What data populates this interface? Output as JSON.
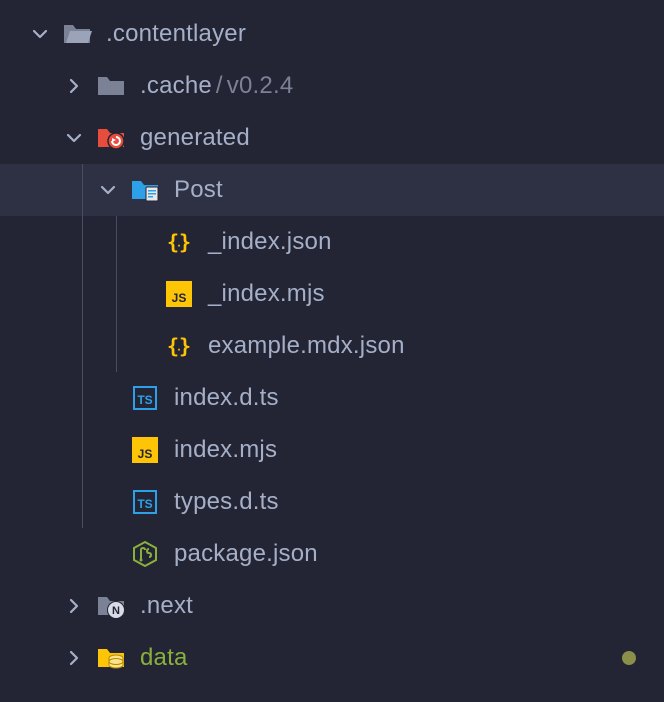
{
  "tree": {
    "contentlayer": {
      "label": ".contentlayer"
    },
    "cache": {
      "label": ".cache",
      "version_sep": "/",
      "version": "v0.2.4"
    },
    "generated": {
      "label": "generated"
    },
    "post": {
      "label": "Post"
    },
    "index_json": {
      "label": "_index.json"
    },
    "index_mjs": {
      "label": "_index.mjs"
    },
    "example_mdx_json": {
      "label": "example.mdx.json"
    },
    "index_d_ts": {
      "label": "index.d.ts"
    },
    "index_mjs2": {
      "label": "index.mjs"
    },
    "types_d_ts": {
      "label": "types.d.ts"
    },
    "package_json": {
      "label": "package.json"
    },
    "next": {
      "label": ".next"
    },
    "data": {
      "label": "data"
    }
  },
  "icons": {
    "js_text": "JS",
    "ts_text": "TS"
  }
}
